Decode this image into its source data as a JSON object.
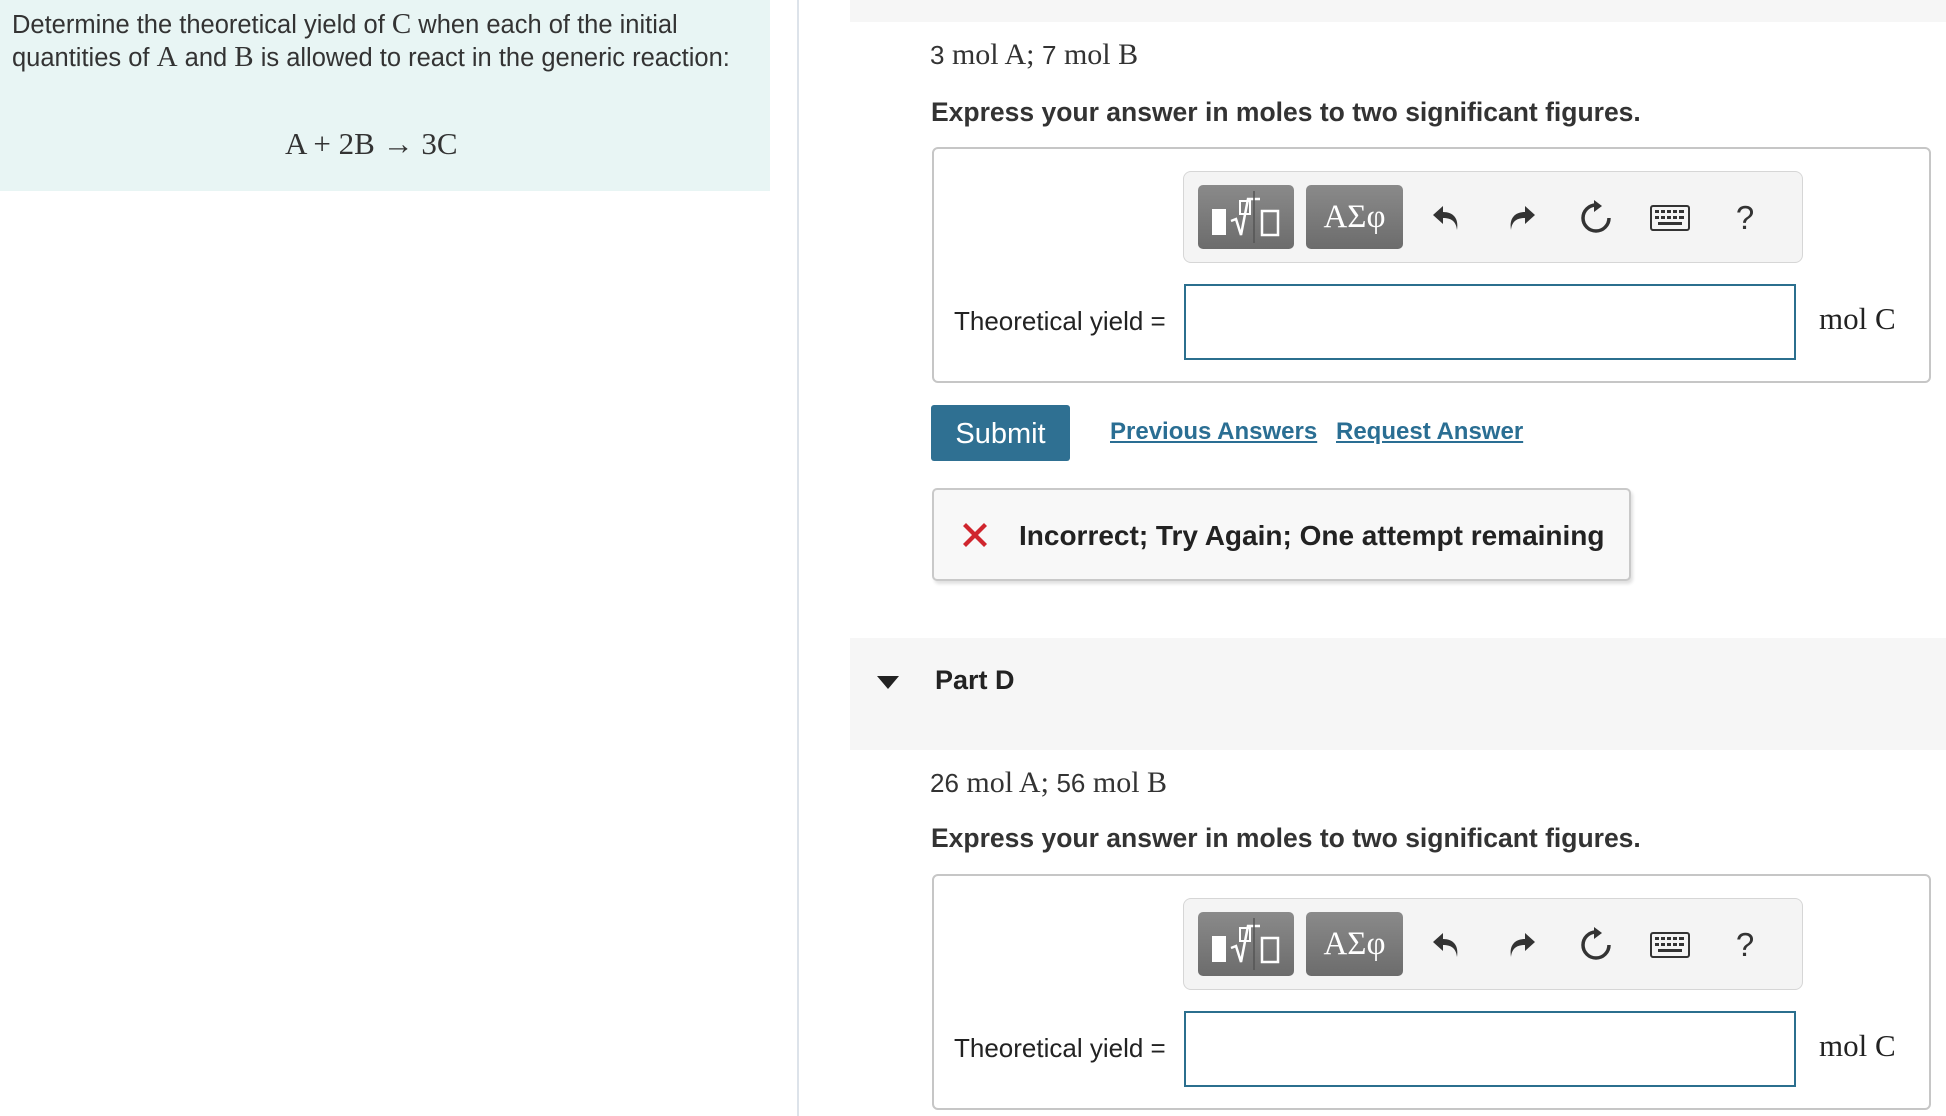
{
  "problem": {
    "intro": {
      "t1": "Determine the theoretical yield of ",
      "m1": "C",
      "t2": " when each of the initial quantities of ",
      "m2": "A",
      "t3": " and ",
      "m3": "B",
      "t4": " is allowed to react in the generic reaction:"
    },
    "equation": "A + 2B → 3C"
  },
  "part_c": {
    "given": {
      "n1": "3",
      "u1": " mol A",
      "sep": "; ",
      "n2": "7",
      "u2": " mol B"
    },
    "instruction": "Express your answer in moles to two significant figures.",
    "toolbar": {
      "greek_label": "ΑΣφ",
      "help_label": "?"
    },
    "field_label": "Theoretical yield =",
    "field_value": "",
    "unit": "mol C",
    "submit_label": "Submit",
    "previous_answers_label": "Previous Answers",
    "request_answer_label": "Request Answer",
    "feedback": "Incorrect; Try Again; One attempt remaining"
  },
  "part_d": {
    "title": "Part D",
    "given": {
      "n1": "26",
      "u1": " mol A",
      "sep": "; ",
      "n2": "56",
      "u2": " mol B"
    },
    "instruction": "Express your answer in moles to two significant figures.",
    "toolbar": {
      "greek_label": "ΑΣφ",
      "help_label": "?"
    },
    "field_label": "Theoretical yield =",
    "field_value": "",
    "unit": "mol C"
  },
  "colors": {
    "accent": "#2f7092",
    "error": "#d0262e",
    "left_panel_bg": "#e8f5f4"
  }
}
